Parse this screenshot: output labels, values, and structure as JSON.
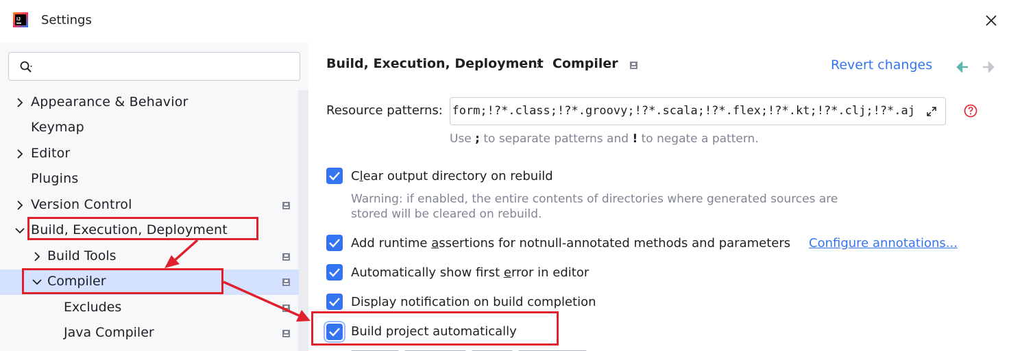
{
  "window": {
    "title": "Settings"
  },
  "sidebar": {
    "search_placeholder": "",
    "items": [
      {
        "label": "Appearance & Behavior",
        "expandable": true,
        "expanded": false
      },
      {
        "label": "Keymap",
        "expandable": false
      },
      {
        "label": "Editor",
        "expandable": true,
        "expanded": false
      },
      {
        "label": "Plugins",
        "expandable": false
      },
      {
        "label": "Version Control",
        "expandable": true,
        "expanded": false
      },
      {
        "label": "Build, Execution, Deployment",
        "expandable": true,
        "expanded": true
      },
      {
        "label": "Build Tools",
        "expandable": true,
        "expanded": false
      },
      {
        "label": "Compiler",
        "expandable": true,
        "expanded": true,
        "selected": true
      },
      {
        "label": "Excludes",
        "expandable": false
      },
      {
        "label": "Java Compiler",
        "expandable": false
      }
    ]
  },
  "header": {
    "breadcrumb_parent": "Build, Execution, Deployment",
    "breadcrumb_separator": "›",
    "breadcrumb_current": "Compiler",
    "revert_label": "Revert changes"
  },
  "resource_patterns": {
    "label": "Resource patterns:",
    "value": "!?*.java;!?*.form;!?*.class;!?*.groovy;!?*.scala;!?*.flex;!?*.kt;!?*.clj;!?*.aj",
    "hint_prefix": "Use ",
    "hint_sep": ";",
    "hint_mid": " to separate patterns and ",
    "hint_neg": "!",
    "hint_suffix": " to negate a pattern."
  },
  "options": {
    "clear_output": {
      "label_pre": "C",
      "label_mnemonic": "l",
      "label_post": "ear output directory on rebuild",
      "checked": true
    },
    "clear_warning_line1": "Warning: if enabled, the entire contents of directories where generated sources are",
    "clear_warning_line2": "stored will be cleared on rebuild.",
    "runtime_assertions": {
      "label_pre": "Add runtime ",
      "label_mnemonic": "a",
      "label_post": "ssertions for notnull-annotated methods and parameters",
      "checked": true
    },
    "configure_annotations": "Configure annotations...",
    "show_first_error": {
      "label_pre": "Automatically show first ",
      "label_mnemonic": "e",
      "label_post": "rror in editor",
      "checked": true
    },
    "notify_build": {
      "label": "Display notification on build completion",
      "checked": true
    },
    "build_auto": {
      "label": "Build project automatically",
      "checked": true
    }
  },
  "colors": {
    "accent": "#3574f0",
    "selection": "#d4e2ff",
    "annotation": "#e0202d"
  }
}
